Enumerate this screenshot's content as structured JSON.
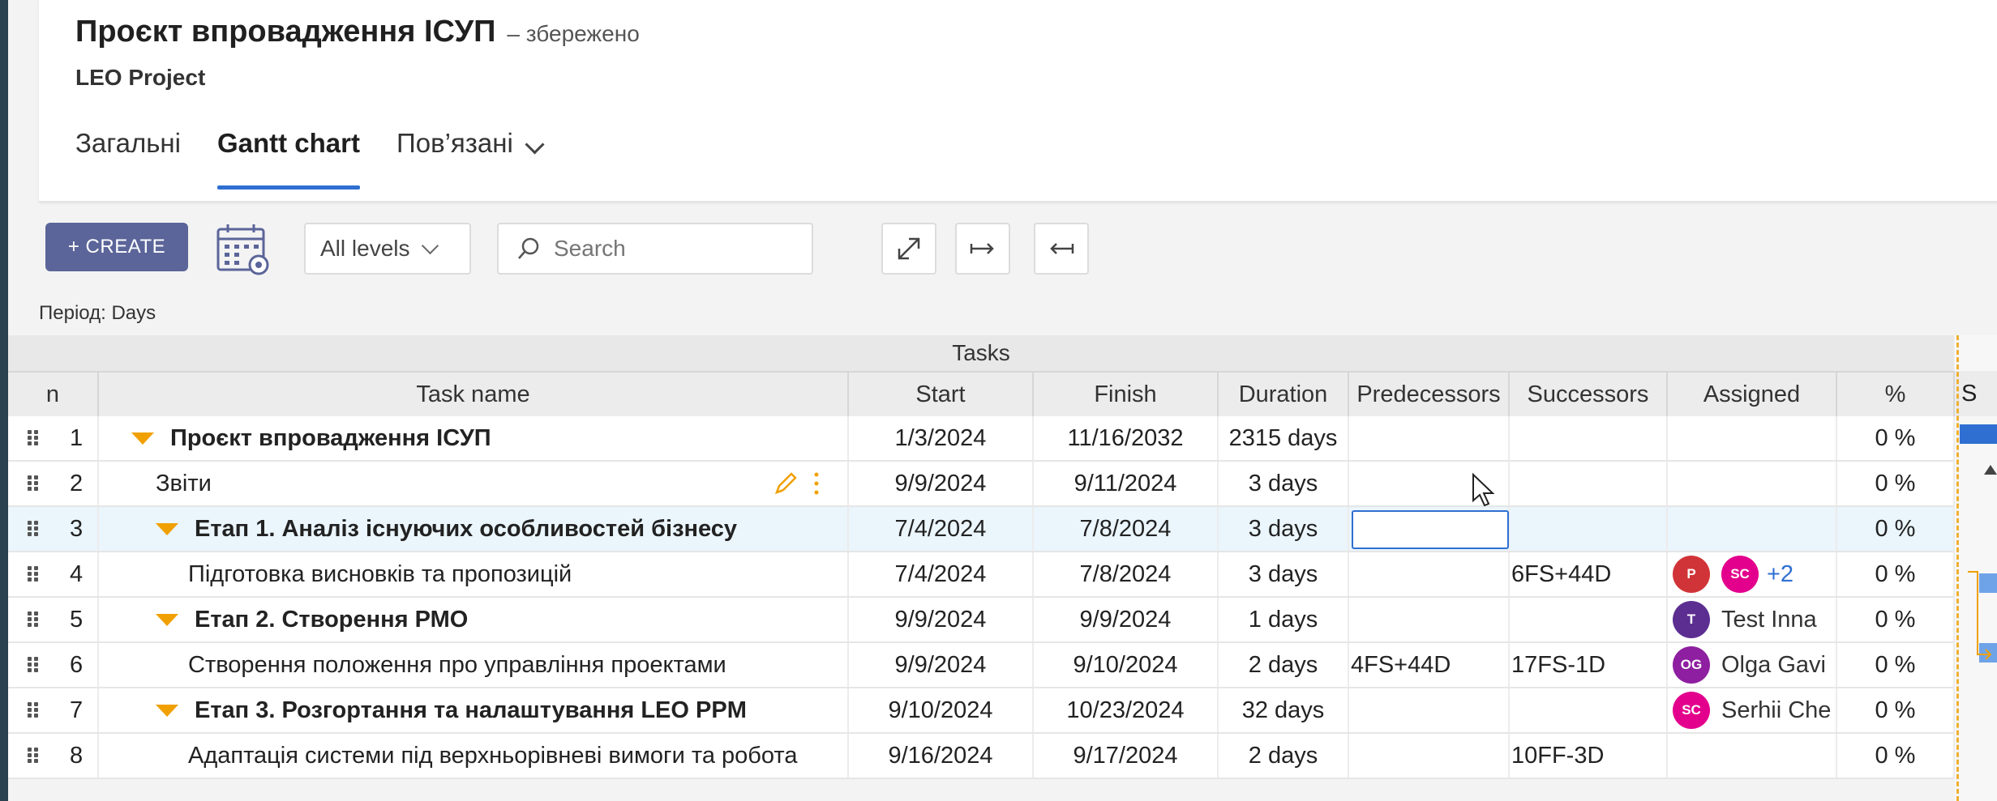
{
  "header": {
    "title": "Проєкт впровадження ІСУП",
    "saved_status": "– збережено",
    "subtitle": "LEO Project",
    "tabs": [
      "Загальні",
      "Gantt chart",
      "Пов’язані"
    ]
  },
  "toolbar": {
    "create_label": "+ CREATE",
    "levels_value": "All levels",
    "search_placeholder": "Search",
    "period_label": "Період:",
    "period_value": "Days"
  },
  "grid": {
    "band_title": "Tasks",
    "columns": [
      "n",
      "Task name",
      "Start",
      "Finish",
      "Duration",
      "Predecessors",
      "Successors",
      "Assigned",
      "%",
      "S"
    ],
    "rows": [
      {
        "n": "1",
        "name": "Проєкт впровадження ІСУП",
        "start": "1/3/2024",
        "finish": "11/16/2032",
        "duration": "2315 days",
        "pred": "",
        "succ": "",
        "pct": "0 %"
      },
      {
        "n": "2",
        "name": "Звіти",
        "start": "9/9/2024",
        "finish": "9/11/2024",
        "duration": "3 days",
        "pred": "",
        "succ": "",
        "pct": "0 %"
      },
      {
        "n": "3",
        "name": "Етап 1. Аналіз існуючих особливостей бізнесу",
        "start": "7/4/2024",
        "finish": "7/8/2024",
        "duration": "3 days",
        "pred": "",
        "succ": "",
        "pct": "0 %"
      },
      {
        "n": "4",
        "name": "Підготовка висновків та пропозицій",
        "start": "7/4/2024",
        "finish": "7/8/2024",
        "duration": "3 days",
        "pred": "",
        "succ": "6FS+44D",
        "pct": "0 %",
        "avatars": [
          {
            "initials": "P",
            "color": "#d13438"
          },
          {
            "initials": "SC",
            "color": "#e3008c"
          }
        ],
        "extra": "+2"
      },
      {
        "n": "5",
        "name": "Етап 2. Створення РМО",
        "start": "9/9/2024",
        "finish": "9/9/2024",
        "duration": "1 days",
        "pred": "",
        "succ": "",
        "pct": "0 %",
        "avatars": [
          {
            "initials": "T",
            "color": "#5c2e91"
          }
        ],
        "assignee": "Test Inna"
      },
      {
        "n": "6",
        "name": "Створення положення про управління проектами",
        "start": "9/9/2024",
        "finish": "9/10/2024",
        "duration": "2 days",
        "pred": "4FS+44D",
        "succ": "17FS-1D",
        "pct": "0 %",
        "avatars": [
          {
            "initials": "OG",
            "color": "#8e1fa0"
          }
        ],
        "assignee": "Olga Gavi"
      },
      {
        "n": "7",
        "name": "Етап 3. Розгортання та налаштування LEO PPM",
        "start": "9/10/2024",
        "finish": "10/23/2024",
        "duration": "32 days",
        "pred": "",
        "succ": "",
        "pct": "0 %",
        "avatars": [
          {
            "initials": "SC",
            "color": "#e3008c"
          }
        ],
        "assignee": "Serhii Che"
      },
      {
        "n": "8",
        "name": "Адаптація системи під верхньорівневі вимоги та робота",
        "start": "9/16/2024",
        "finish": "9/17/2024",
        "duration": "2 days",
        "pred": "",
        "succ": "10FF-3D",
        "pct": "0 %"
      }
    ]
  },
  "colors": {
    "accent": "#2f6fd1",
    "create_button": "#5b6599",
    "collapse_triangle": "#f0a000",
    "edit_icon": "#f0a000"
  },
  "icons": [
    "calendar-settings-icon",
    "search-icon",
    "expand-icon",
    "indent-icon",
    "outdent-icon",
    "pencil-icon",
    "more-vertical-icon",
    "drag-handle-icon",
    "collapse-triangle-icon",
    "mouse-cursor-icon"
  ]
}
